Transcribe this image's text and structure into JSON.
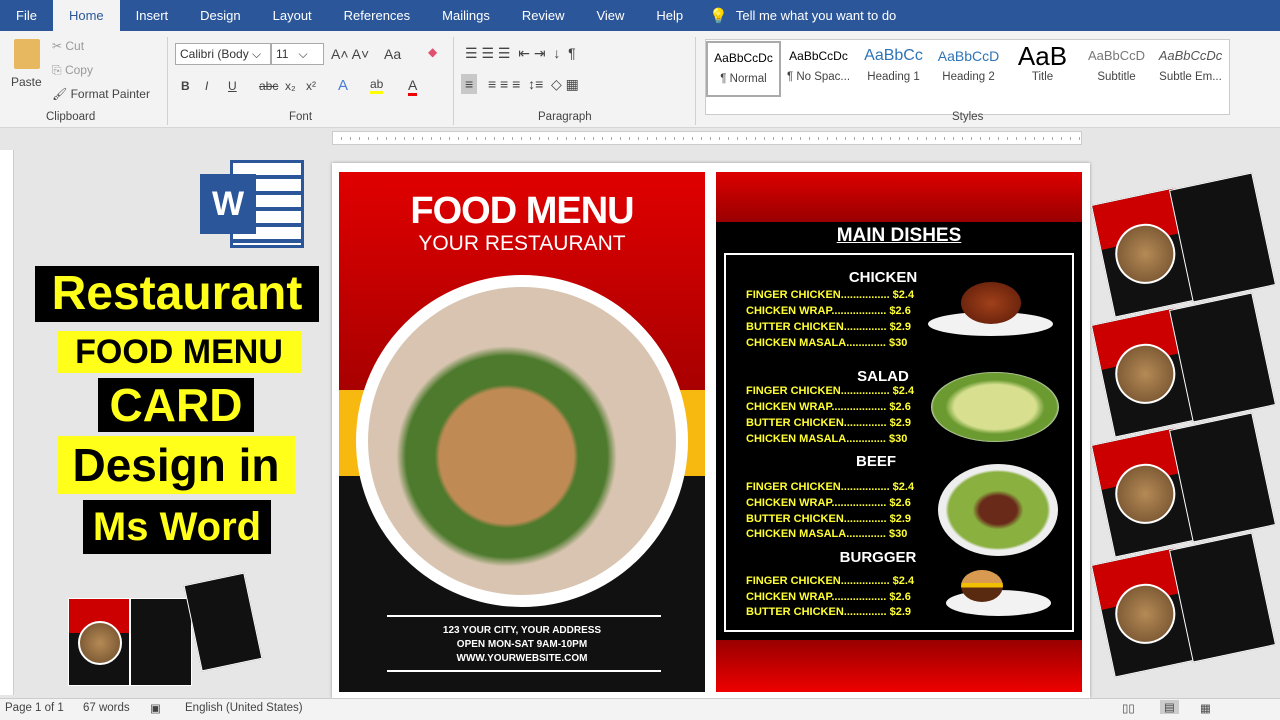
{
  "menu": {
    "tabs": [
      "File",
      "Home",
      "Insert",
      "Design",
      "Layout",
      "References",
      "Mailings",
      "Review",
      "View",
      "Help"
    ],
    "active": "Home",
    "tell_me": "Tell me what you want to do"
  },
  "ribbon": {
    "clipboard": {
      "paste": "Paste",
      "cut": "Cut",
      "copy": "Copy",
      "format_painter": "Format Painter",
      "label": "Clipboard"
    },
    "font": {
      "family": "Calibri (Body",
      "size": "11",
      "label": "Font",
      "bold": "B",
      "italic": "I",
      "underline": "U",
      "strike": "abc",
      "sub": "x₂",
      "sup": "x²",
      "case": "Aa"
    },
    "paragraph": {
      "label": "Paragraph"
    },
    "styles": {
      "label": "Styles",
      "items": [
        {
          "preview": "AaBbCcDc",
          "name": "¶ Normal"
        },
        {
          "preview": "AaBbCcDc",
          "name": "¶ No Spac..."
        },
        {
          "preview": "AaBbCc",
          "name": "Heading 1"
        },
        {
          "preview": "AaBbCcD",
          "name": "Heading 2"
        },
        {
          "preview": "AaB",
          "name": "Title"
        },
        {
          "preview": "AaBbCcD",
          "name": "Subtitle"
        },
        {
          "preview": "AaBbCcDc",
          "name": "Subtle Em..."
        }
      ]
    }
  },
  "overlay": {
    "line1": "Restaurant",
    "line2": "FOOD MENU",
    "line3": "CARD",
    "line4": "Design in",
    "line5": "Ms Word",
    "word_logo": "W"
  },
  "menu_card": {
    "title": "FOOD MENU",
    "subtitle": "YOUR RESTAURANT",
    "address": "123 YOUR CITY, YOUR ADDRESS",
    "hours": "OPEN MON-SAT 9AM-10PM",
    "website": "WWW.YOURWEBSITE.COM",
    "main_heading": "MAIN DISHES",
    "sections": [
      {
        "name": "CHICKEN",
        "items": [
          "FINGER CHICKEN................ $2.4",
          "CHICKEN WRAP.................. $2.6",
          "BUTTER CHICKEN.............. $2.9",
          "CHICKEN MASALA............. $30"
        ]
      },
      {
        "name": "SALAD",
        "items": [
          "FINGER CHICKEN................ $2.4",
          "CHICKEN WRAP.................. $2.6",
          "BUTTER CHICKEN.............. $2.9",
          "CHICKEN MASALA............. $30"
        ]
      },
      {
        "name": "BEEF",
        "items": [
          "FINGER CHICKEN................ $2.4",
          "CHICKEN WRAP.................. $2.6",
          "BUTTER CHICKEN.............. $2.9",
          "CHICKEN MASALA............. $30"
        ]
      },
      {
        "name": "BURGGER",
        "items": [
          "FINGER CHICKEN................ $2.4",
          "CHICKEN WRAP.................. $2.6",
          "BUTTER CHICKEN.............. $2.9"
        ]
      }
    ]
  },
  "status": {
    "page": "Page 1 of 1",
    "words": "67 words",
    "language": "English (United States)"
  },
  "colors": {
    "word_blue": "#2b579a",
    "menu_red": "#d00000",
    "menu_yellow": "#f7b90f",
    "price_yellow": "#ffff33"
  }
}
